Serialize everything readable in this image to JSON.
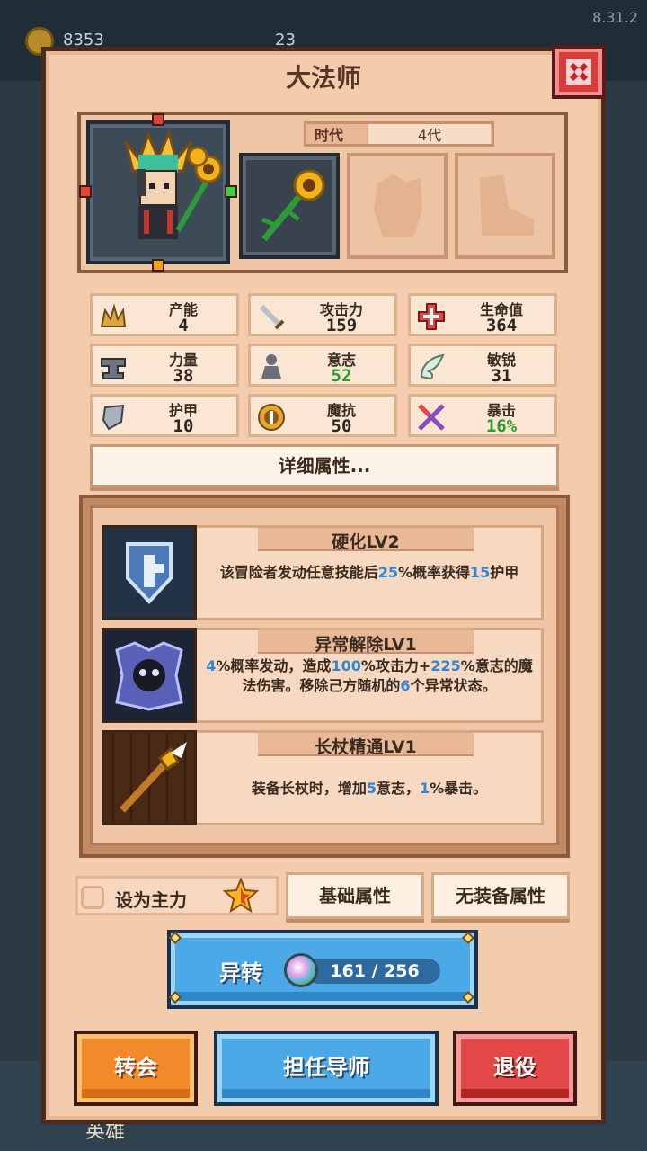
{
  "version": "8.31.2",
  "background": {
    "coins": "8353",
    "swords": "23",
    "bottom_label": "英雄"
  },
  "dialog": {
    "title": "大法师"
  },
  "hero": {
    "era_label": "时代",
    "era_value": "4代"
  },
  "stats": [
    {
      "label": "产能",
      "value": "4",
      "icon": "crown-icon",
      "highlight": false
    },
    {
      "label": "攻击力",
      "value": "159",
      "icon": "sword-icon",
      "highlight": false
    },
    {
      "label": "生命值",
      "value": "364",
      "icon": "health-cross-icon",
      "highlight": false
    },
    {
      "label": "力量",
      "value": "38",
      "icon": "anvil-icon",
      "highlight": false
    },
    {
      "label": "意志",
      "value": "52",
      "icon": "will-figure-icon",
      "highlight": true
    },
    {
      "label": "敏锐",
      "value": "31",
      "icon": "wing-icon",
      "highlight": false
    },
    {
      "label": "护甲",
      "value": "10",
      "icon": "shield-icon",
      "highlight": false
    },
    {
      "label": "魔抗",
      "value": "50",
      "icon": "magic-resist-icon",
      "highlight": false
    },
    {
      "label": "暴击",
      "value": "16%",
      "icon": "crossed-swords-icon",
      "highlight": true
    }
  ],
  "detail_button": "详细属性...",
  "skills": [
    {
      "title": "硬化LV2",
      "icon": "shield-skill-icon",
      "desc": [
        {
          "t": "该冒险者发动任意技能后"
        },
        {
          "t": "25",
          "hl": true
        },
        {
          "t": "%概率获得"
        },
        {
          "t": "15",
          "hl": true
        },
        {
          "t": "护甲"
        }
      ]
    },
    {
      "title": "异常解除LV1",
      "icon": "skull-skill-icon",
      "desc": [
        {
          "t": "4",
          "hl": true
        },
        {
          "t": "%概率发动，造成"
        },
        {
          "t": "100",
          "hl": true
        },
        {
          "t": "%攻击力+"
        },
        {
          "t": "225",
          "hl": true
        },
        {
          "t": "%意志的魔法伤害。移除己方随机的"
        },
        {
          "t": "6",
          "hl": true
        },
        {
          "t": "个异常状态。"
        }
      ]
    },
    {
      "title": "长杖精通LV1",
      "icon": "staff-skill-icon",
      "desc": [
        {
          "t": "装备长杖时，增加"
        },
        {
          "t": "5",
          "hl": true
        },
        {
          "t": "意志，"
        },
        {
          "t": "1",
          "hl": true
        },
        {
          "t": "%暴击。"
        }
      ]
    }
  ],
  "set_main_label": "设为主力",
  "tabs": {
    "base": "基础属性",
    "no_equip": "无装备属性"
  },
  "transform": {
    "label": "异转",
    "count": "161 / 256"
  },
  "actions": {
    "transfer": "转会",
    "mentor": "担任导师",
    "retire": "退役"
  },
  "colors": {
    "highlight_blue": "#2f86d6",
    "highlight_green": "#2a9c2e",
    "panel_bg": "#f3ccae",
    "close_red": "#d93a3a"
  }
}
